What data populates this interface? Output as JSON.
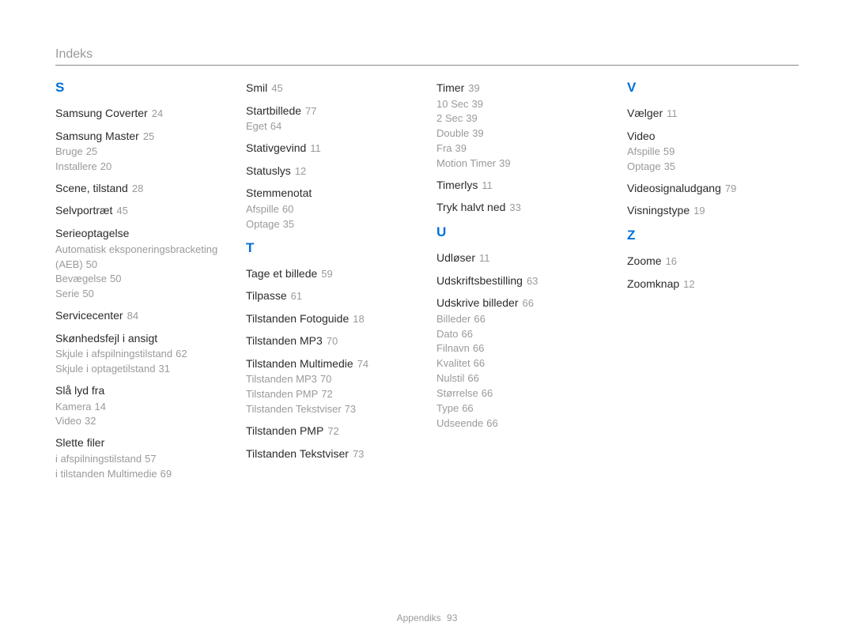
{
  "header": {
    "title": "Indeks"
  },
  "footer": {
    "label": "Appendiks",
    "page": "93"
  },
  "columns": [
    {
      "blocks": [
        {
          "letter": "S",
          "entries": [
            {
              "term": "Samsung Coverter",
              "page": "24"
            },
            {
              "term": "Samsung Master",
              "page": "25",
              "subs": [
                {
                  "term": "Bruge",
                  "page": "25"
                },
                {
                  "term": "Installere",
                  "page": "20"
                }
              ]
            },
            {
              "term": "Scene, tilstand",
              "page": "28"
            },
            {
              "term": "Selvportræt",
              "page": "45"
            },
            {
              "term": "Serieoptagelse",
              "subs": [
                {
                  "term": "Automatisk eksponeringsbracketing (AEB)",
                  "page": "50"
                },
                {
                  "term": "Bevægelse",
                  "page": "50"
                },
                {
                  "term": "Serie",
                  "page": "50"
                }
              ]
            },
            {
              "term": "Servicecenter",
              "page": "84"
            },
            {
              "term": "Skønhedsfejl i ansigt",
              "subs": [
                {
                  "term": "Skjule i afspilningstilstand",
                  "page": "62"
                },
                {
                  "term": "Skjule i optagetilstand",
                  "page": "31"
                }
              ]
            },
            {
              "term": "Slå lyd fra",
              "subs": [
                {
                  "term": "Kamera",
                  "page": "14"
                },
                {
                  "term": "Video",
                  "page": "32"
                }
              ]
            },
            {
              "term": "Slette filer",
              "subs": [
                {
                  "term": "i afspilningstilstand",
                  "page": "57"
                },
                {
                  "term": "i tilstanden Multimedie",
                  "page": "69"
                }
              ]
            }
          ]
        }
      ]
    },
    {
      "blocks": [
        {
          "entries": [
            {
              "term": "Smil",
              "page": "45"
            },
            {
              "term": "Startbillede",
              "page": "77",
              "subs": [
                {
                  "term": "Eget",
                  "page": "64"
                }
              ]
            },
            {
              "term": "Stativgevind",
              "page": "11"
            },
            {
              "term": "Statuslys",
              "page": "12"
            },
            {
              "term": "Stemmenotat",
              "subs": [
                {
                  "term": "Afspille",
                  "page": "60"
                },
                {
                  "term": "Optage",
                  "page": "35"
                }
              ]
            }
          ]
        },
        {
          "letter": "T",
          "entries": [
            {
              "term": "Tage et billede",
              "page": "59"
            },
            {
              "term": "Tilpasse",
              "page": "61"
            },
            {
              "term": "Tilstanden Fotoguide",
              "page": "18"
            },
            {
              "term": "Tilstanden MP3",
              "page": "70"
            },
            {
              "term": "Tilstanden Multimedie",
              "page": "74",
              "subs": [
                {
                  "term": "Tilstanden MP3",
                  "page": "70"
                },
                {
                  "term": "Tilstanden PMP",
                  "page": "72"
                },
                {
                  "term": "Tilstanden Tekstviser",
                  "page": "73"
                }
              ]
            },
            {
              "term": "Tilstanden PMP",
              "page": "72"
            },
            {
              "term": "Tilstanden Tekstviser",
              "page": "73"
            }
          ]
        }
      ]
    },
    {
      "blocks": [
        {
          "entries": [
            {
              "term": "Timer",
              "page": "39",
              "subs": [
                {
                  "term": "10 Sec",
                  "page": "39"
                },
                {
                  "term": "2 Sec",
                  "page": "39"
                },
                {
                  "term": "Double",
                  "page": "39"
                },
                {
                  "term": "Fra",
                  "page": "39"
                },
                {
                  "term": "Motion Timer",
                  "page": "39"
                }
              ]
            },
            {
              "term": "Timerlys",
              "page": "11"
            },
            {
              "term": "Tryk halvt ned",
              "page": "33"
            }
          ]
        },
        {
          "letter": "U",
          "entries": [
            {
              "term": "Udløser",
              "page": "11"
            },
            {
              "term": "Udskriftsbestilling",
              "page": "63"
            },
            {
              "term": "Udskrive billeder",
              "page": "66",
              "subs": [
                {
                  "term": "Billeder",
                  "page": "66"
                },
                {
                  "term": "Dato",
                  "page": "66"
                },
                {
                  "term": "Filnavn",
                  "page": "66"
                },
                {
                  "term": "Kvalitet",
                  "page": "66"
                },
                {
                  "term": "Nulstil",
                  "page": "66"
                },
                {
                  "term": "Størrelse",
                  "page": "66"
                },
                {
                  "term": "Type",
                  "page": "66"
                },
                {
                  "term": "Udseende",
                  "page": "66"
                }
              ]
            }
          ]
        }
      ]
    },
    {
      "blocks": [
        {
          "letter": "V",
          "entries": [
            {
              "term": "Vælger",
              "page": "11"
            },
            {
              "term": "Video",
              "subs": [
                {
                  "term": "Afspille",
                  "page": "59"
                },
                {
                  "term": "Optage",
                  "page": "35"
                }
              ]
            },
            {
              "term": "Videosignaludgang",
              "page": "79"
            },
            {
              "term": "Visningstype",
              "page": "19"
            }
          ]
        },
        {
          "letter": "Z",
          "entries": [
            {
              "term": "Zoome",
              "page": "16"
            },
            {
              "term": "Zoomknap",
              "page": "12"
            }
          ]
        }
      ]
    }
  ]
}
